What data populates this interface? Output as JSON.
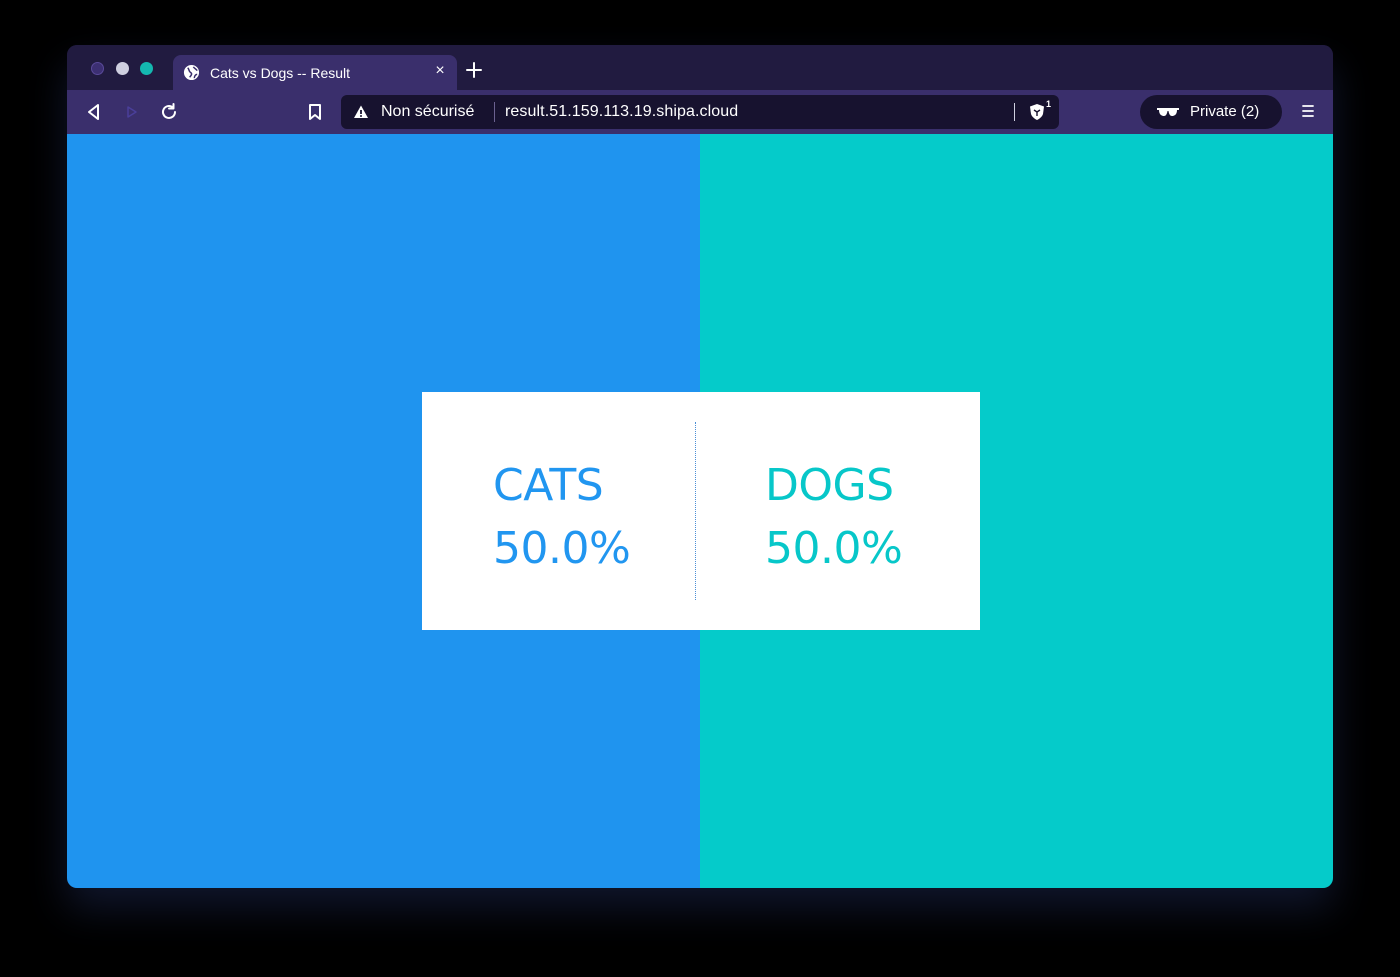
{
  "browser": {
    "tab": {
      "title": "Cats vs Dogs -- Result",
      "close_label": "×"
    },
    "urlbar": {
      "security_label": "Non sécurisé",
      "url": "result.51.159.113.19.shipa.cloud",
      "shield_count": "1"
    },
    "private_label": "Private (2)"
  },
  "result": {
    "cats": {
      "label": "CATS",
      "percent": "50.0%"
    },
    "dogs": {
      "label": "DOGS",
      "percent": "50.0%"
    }
  },
  "colors": {
    "cats": "#1f94ef",
    "dogs": "#05cbca",
    "chrome": "#3a2f6c"
  }
}
